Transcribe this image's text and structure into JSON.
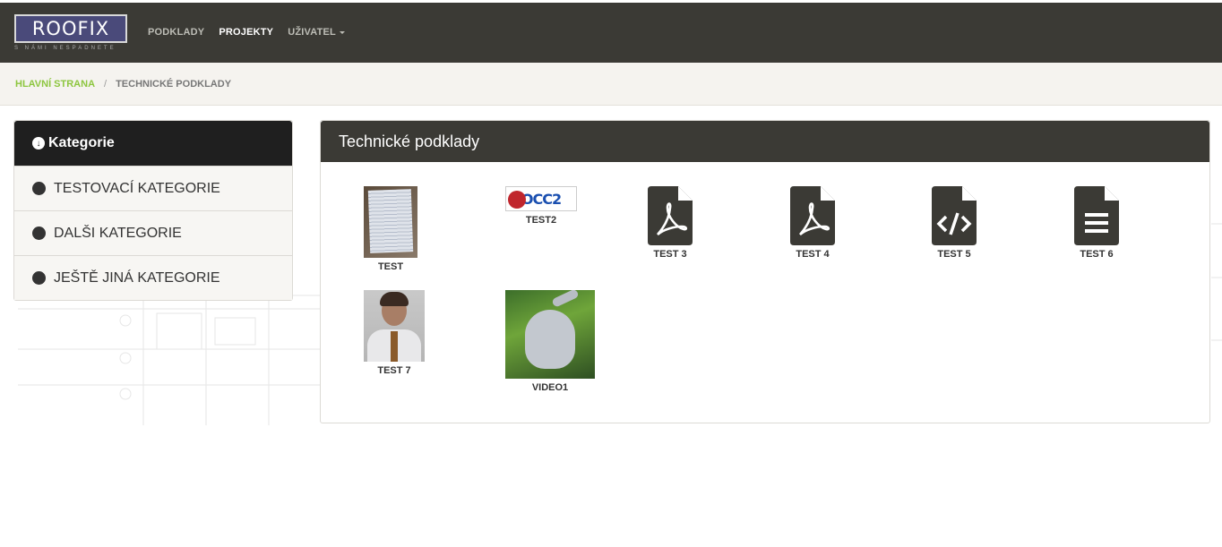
{
  "header": {
    "logo_text": "ROOFIX",
    "logo_tagline": "S NÁMI NESPADNETE",
    "nav": [
      {
        "label": "PODKLADY"
      },
      {
        "label": "PROJEKTY"
      },
      {
        "label": "UŽIVATEL"
      }
    ]
  },
  "breadcrumb": {
    "home": "HLAVNÍ STRANA",
    "separator": "/",
    "current": "TECHNICKÉ PODKLADY"
  },
  "sidebar": {
    "title": "Kategorie",
    "items": [
      {
        "label": "TESTOVACÍ KATEGORIE"
      },
      {
        "label": "DALŠI KATEGORIE"
      },
      {
        "label": "JEŠTĚ JINÁ KATEGORIE"
      }
    ]
  },
  "panel": {
    "title": "Technické podklady",
    "files": [
      {
        "label": "TEST",
        "kind": "image"
      },
      {
        "label": "TEST2",
        "kind": "image"
      },
      {
        "label": "TEST 3",
        "kind": "pdf-icon"
      },
      {
        "label": "TEST 4",
        "kind": "pdf-icon"
      },
      {
        "label": "TEST 5",
        "kind": "code-file-icon"
      },
      {
        "label": "TEST 6",
        "kind": "text-file-icon"
      },
      {
        "label": "TEST 7",
        "kind": "image"
      },
      {
        "label": "VIDEO1",
        "kind": "video"
      }
    ]
  },
  "colors": {
    "topbar": "#3b3a35",
    "accent_green": "#8dc63f",
    "sidebar_head": "#1f1f1f",
    "breadcrumb_bg": "#f5f3ef"
  }
}
